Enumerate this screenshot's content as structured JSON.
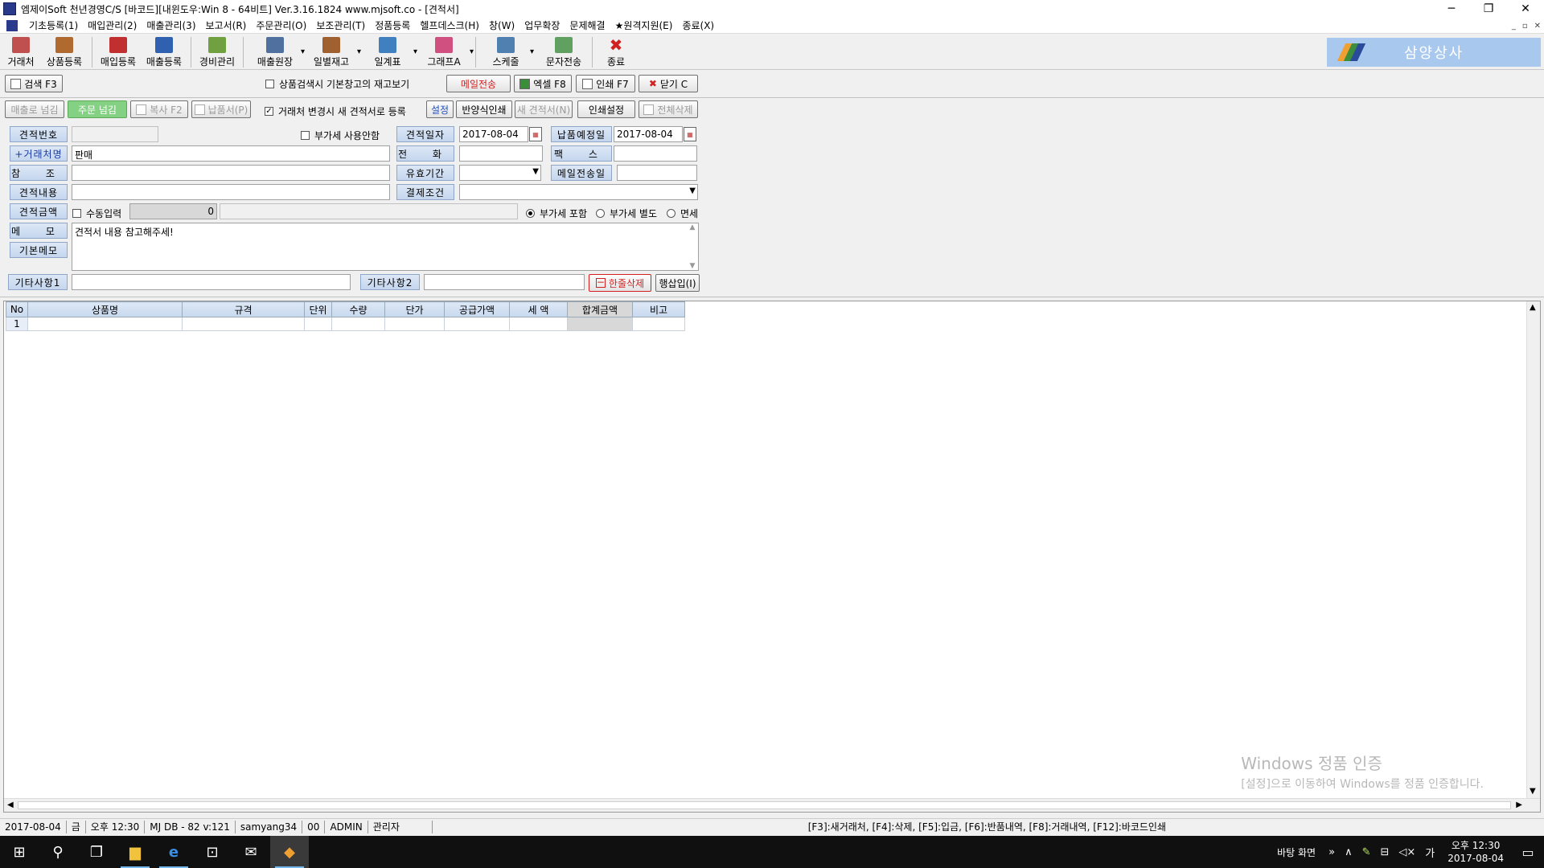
{
  "window": {
    "title": "엠제이Soft 천년경영C/S [바코드][내윈도우:Win 8 - 64비트] Ver.3.16.1824          www.mjsoft.co - [견적서]",
    "minimize": "─",
    "restore": "❐",
    "close": "✕"
  },
  "menu": {
    "items": [
      "기초등록(1)",
      "매입관리(2)",
      "매출관리(3)",
      "보고서(R)",
      "주문관리(O)",
      "보조관리(T)",
      "정품등록",
      "헬프데스크(H)",
      "창(W)",
      "업무확장",
      "문제해결",
      "★원격지원(E)",
      "종료(X)"
    ],
    "mdi_controls": [
      "_",
      "▫",
      "✕"
    ]
  },
  "toolbar": {
    "buttons": [
      {
        "label": "거래처",
        "icon": "customer-icon",
        "color": "#c05050"
      },
      {
        "label": "상품등록",
        "icon": "product-icon",
        "color": "#b06a30"
      },
      {
        "label": "매입등록",
        "icon": "purchase-icon",
        "color": "#c03030"
      },
      {
        "label": "매출등록",
        "icon": "sales-icon",
        "color": "#3060b0"
      },
      {
        "label": "경비관리",
        "icon": "expense-icon",
        "color": "#70a040"
      },
      {
        "label": "매출원장",
        "icon": "ledger-icon",
        "color": "#5070a0"
      },
      {
        "label": "일별재고",
        "icon": "inventory-icon",
        "color": "#a06030"
      },
      {
        "label": "일계표",
        "icon": "daily-report-icon",
        "color": "#4080c0"
      },
      {
        "label": "그래프A",
        "icon": "graph-icon",
        "color": "#d05080"
      },
      {
        "label": "스케줄",
        "icon": "schedule-icon",
        "color": "#5080b0"
      },
      {
        "label": "문자전송",
        "icon": "sms-icon",
        "color": "#60a060"
      },
      {
        "label": "종료",
        "icon": "exit-icon",
        "color": "#d02020"
      }
    ],
    "brand": "삼양상사"
  },
  "actions": {
    "search": "검색 F3",
    "stock_check": "상품검색시 기본창고의 재고보기",
    "mail_send": "메일전송",
    "excel": "엑셀 F8",
    "print": "인쇄 F7",
    "close": "닫기 C",
    "to_sales": "매출로 넘김",
    "to_order": "주문 넘김",
    "copy": "복사 F2",
    "delivery": "납품서(P)",
    "new_on_change": "거래처 변경시 새 견적서로 등록",
    "settings": "설정",
    "half_print": "반양식인쇄",
    "new_quote": "새 견적서(N)",
    "print_settings": "인쇄설정",
    "delete_all": "전체삭제"
  },
  "form": {
    "labels": {
      "quote_no": "견적번호",
      "customer": "+거래처명",
      "reference": "참 조",
      "content": "견적내용",
      "amount": "견적금액",
      "memo": "메 모",
      "basic_memo": "기본메모",
      "etc1": "기타사항1",
      "etc2": "기타사항2",
      "quote_date": "견적일자",
      "phone": "전 화",
      "validity": "유효기간",
      "payment": "결제조건",
      "delivery_date": "납품예정일",
      "fax": "팩 스",
      "mail_sent": "메일전송일"
    },
    "values": {
      "quote_no": "",
      "customer": "판매",
      "reference": "",
      "content": "",
      "amount": "0",
      "memo": "견적서 내용 참고해주세!",
      "etc1": "",
      "etc2": "",
      "quote_date": "2017-08-04",
      "phone": "",
      "validity": "",
      "payment": "",
      "delivery_date": "2017-08-04",
      "fax": "",
      "mail_sent": ""
    },
    "vat_unused": "부가세 사용안함",
    "manual_input": "수동입력",
    "vat_options": [
      "부가세 포함",
      "부가세 별도",
      "면세"
    ],
    "vat_selected": "부가세 포함",
    "delete_row": "한줄삭제",
    "insert_row": "행삽입(I)"
  },
  "grid": {
    "columns": [
      "No",
      "상품명",
      "규격",
      "단위",
      "수량",
      "단가",
      "공급가액",
      "세 액",
      "합계금액",
      "비고"
    ],
    "rows": [
      [
        "1",
        "",
        "",
        "",
        "",
        "",
        "",
        "",
        "",
        ""
      ]
    ]
  },
  "watermark": {
    "line1": "Windows 정품 인증",
    "line2": "[설정]으로 이동하여 Windows를 정품 인증합니다."
  },
  "status": {
    "cells": [
      "2017-08-04",
      "금",
      "오후 12:30",
      "MJ DB - 82 v:121",
      "samyang34",
      "00",
      "ADMIN",
      "관리자"
    ],
    "hint": "[F3]:새거래처, [F4]:삭제, [F5]:입금, [F6]:반품내역, [F8]:거래내역, [F12]:바코드인쇄"
  },
  "taskbar": {
    "desktop": "바탕 화면",
    "ime": "가",
    "time": "오후 12:30",
    "date": "2017-08-04"
  }
}
